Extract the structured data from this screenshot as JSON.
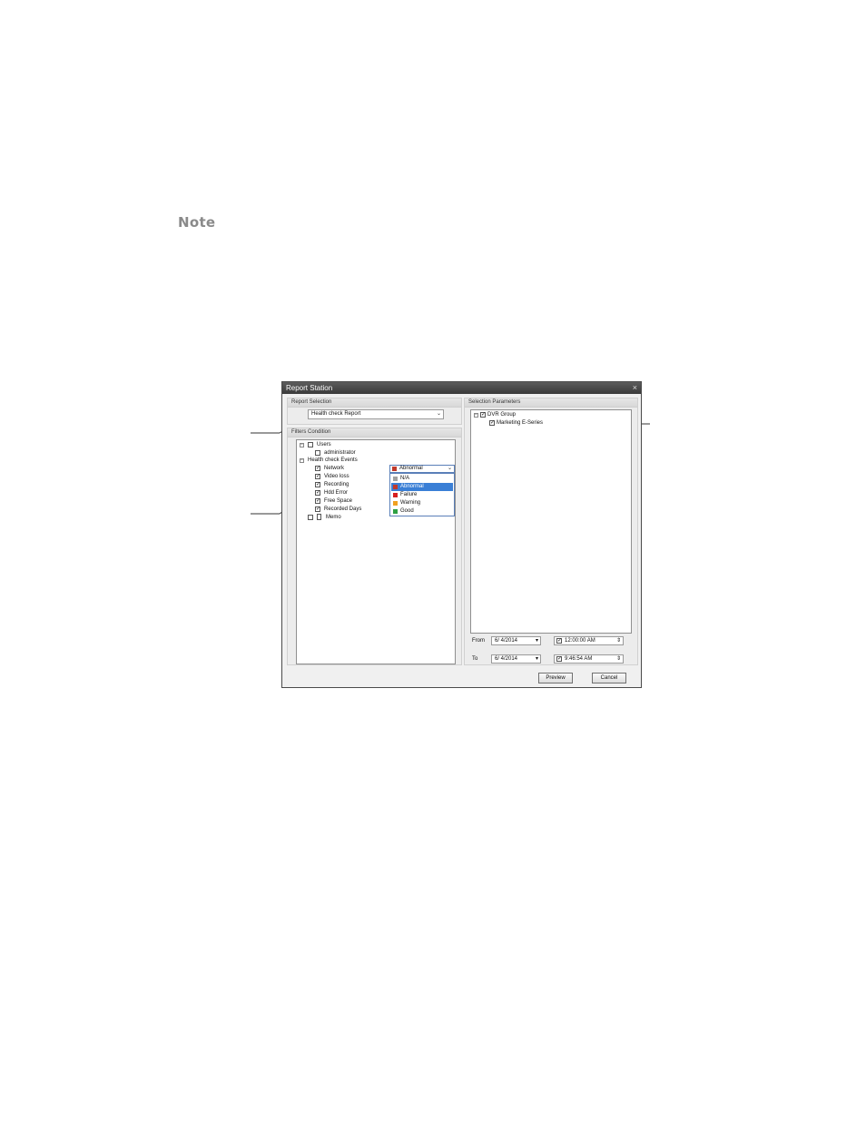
{
  "note_label": "Note",
  "window": {
    "title": "Report Station",
    "close_glyph": "×"
  },
  "report_selection": {
    "heading": "Report Selection",
    "value": "Health check Report",
    "arrow": "⌄"
  },
  "filters": {
    "heading": "Filters Condition",
    "users_label": "Users",
    "admin_label": "administrator",
    "events_label": "Health check Events",
    "events": [
      "Network",
      "Video loss",
      "Recording",
      "Hdd Error",
      "Free Space",
      "Recorded Days"
    ],
    "memo_label": "Memo",
    "status_value": "Abnormal",
    "status_arrow": "⌄",
    "options": [
      {
        "label": "N/A",
        "color": "#a0a0a0"
      },
      {
        "label": "Abnormal",
        "color": "#c0392b"
      },
      {
        "label": "Failure",
        "color": "#d62020"
      },
      {
        "label": "Warning",
        "color": "#f0a020"
      },
      {
        "label": "Good",
        "color": "#2ea043"
      }
    ]
  },
  "selection_params": {
    "heading": "Selection Parameters",
    "group_label": "DVR Group",
    "child_label": "Marketing E-Series",
    "from_label": "From",
    "to_label": "To",
    "from_date": "6/ 4/2014",
    "from_time": "12:00:00 AM",
    "to_date": "6/ 4/2014",
    "to_time": "9:46:54 AM"
  },
  "buttons": {
    "preview": "Preview",
    "cancel": "Cancel"
  },
  "glyphs": {
    "check": "✓",
    "minus": "−",
    "spin": "⇕",
    "cal_arrow": "▾"
  }
}
